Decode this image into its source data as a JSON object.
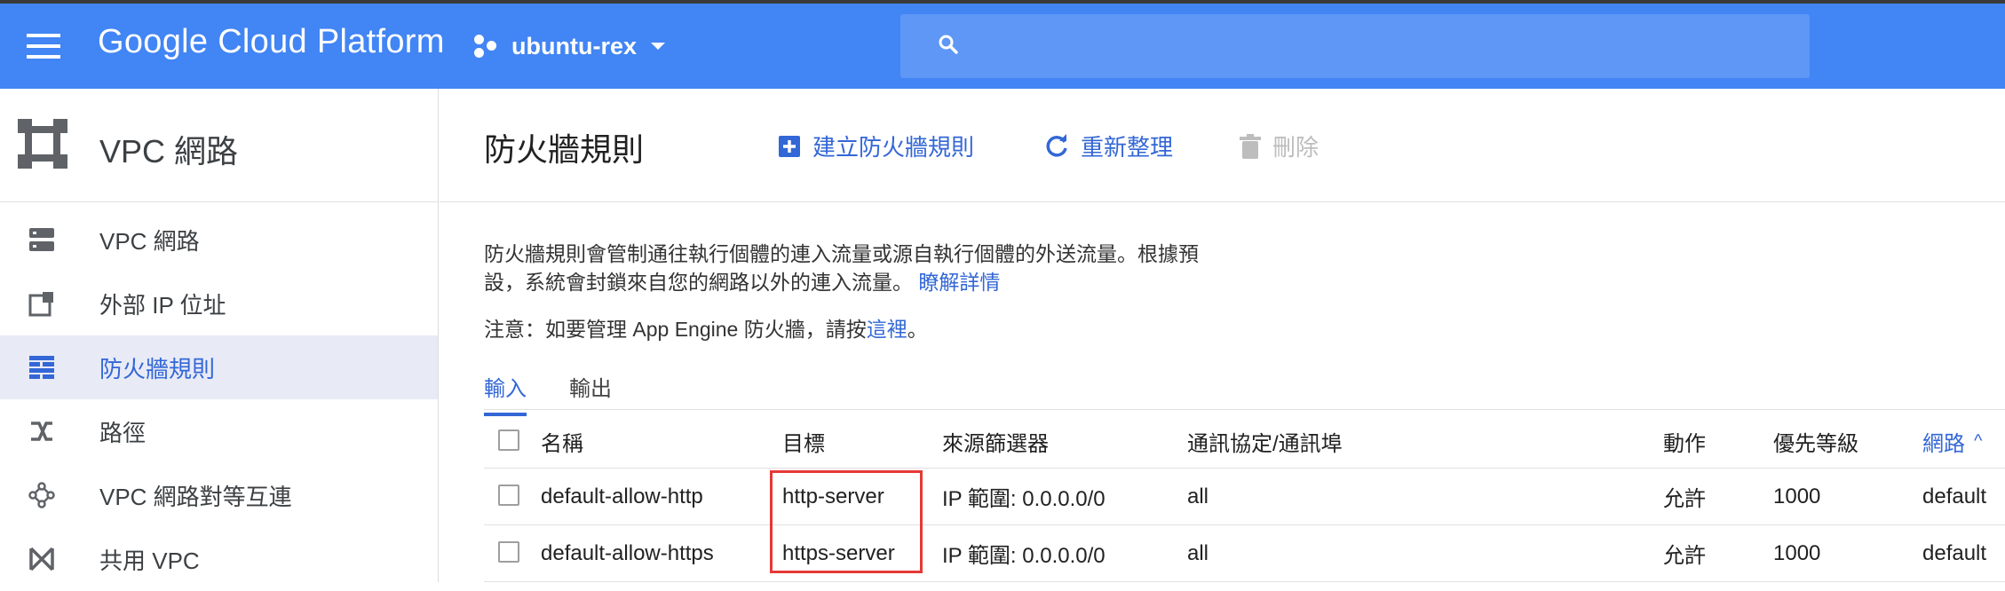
{
  "header": {
    "brand": "Google Cloud Platform",
    "project": "ubuntu-rex",
    "search_placeholder": ""
  },
  "sidebar": {
    "title": "VPC 網路",
    "items": [
      {
        "label": "VPC 網路",
        "icon": "network-icon",
        "active": false
      },
      {
        "label": "外部 IP 位址",
        "icon": "external-ip-icon",
        "active": false
      },
      {
        "label": "防火牆規則",
        "icon": "firewall-icon",
        "active": true
      },
      {
        "label": "路徑",
        "icon": "route-icon",
        "active": false
      },
      {
        "label": "VPC 網路對等互連",
        "icon": "peering-icon",
        "active": false
      },
      {
        "label": "共用 VPC",
        "icon": "shared-vpc-icon",
        "active": false
      }
    ]
  },
  "main": {
    "title": "防火牆規則",
    "actions": {
      "create": "建立防火牆規則",
      "refresh": "重新整理",
      "delete": "刪除"
    },
    "description_line1": "防火牆規則會管制通往執行個體的連入流量或源自執行個體的外送流量。根據預",
    "description_line2": "設，系統會封鎖來自您的網路以外的連入流量。",
    "learn_more": "瞭解詳情",
    "note_prefix": "注意：如要管理 App Engine 防火牆，請按",
    "note_link": "這裡",
    "note_suffix": "。",
    "tabs": [
      "輸入",
      "輸出"
    ]
  },
  "table": {
    "columns": [
      "名稱",
      "目標",
      "來源篩選器",
      "通訊協定/通訊埠",
      "動作",
      "優先等級",
      "網路"
    ],
    "sort_indicator": "^",
    "rows": [
      {
        "name": "default-allow-http",
        "target": "http-server",
        "source": "IP 範圍: 0.0.0.0/0",
        "protocol": "all",
        "action": "允許",
        "priority": "1000",
        "network": "default"
      },
      {
        "name": "default-allow-https",
        "target": "https-server",
        "source": "IP 範圍: 0.0.0.0/0",
        "protocol": "all",
        "action": "允許",
        "priority": "1000",
        "network": "default"
      }
    ]
  },
  "colors": {
    "header_bg": "#4285f4",
    "accent": "#3367d6",
    "highlight": "#e53935"
  }
}
